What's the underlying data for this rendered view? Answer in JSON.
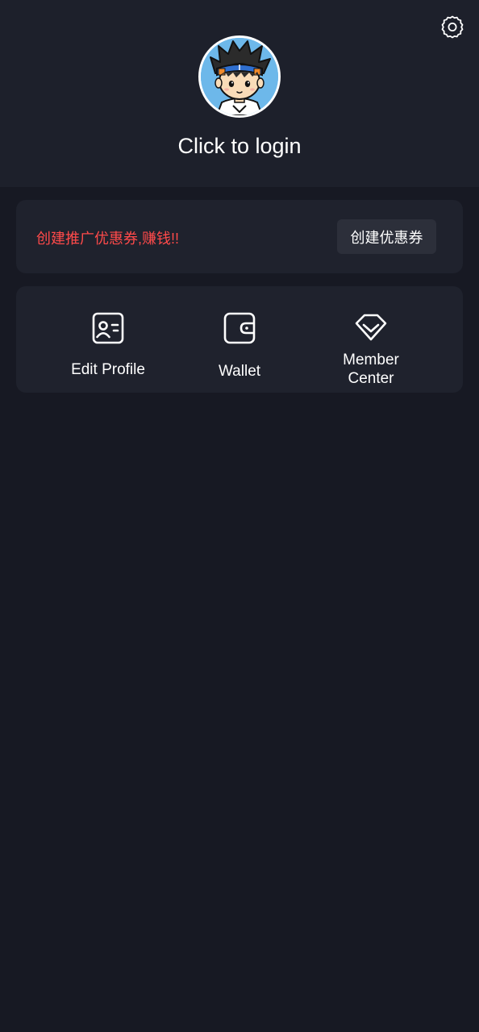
{
  "header": {
    "login_text": "Click to login",
    "settings_icon": "gear-icon",
    "avatar": "cartoon-boy-avatar"
  },
  "promo": {
    "text": "创建推广优惠券,赚钱!!",
    "button_label": "创建优惠券",
    "text_color": "#ff4a4a"
  },
  "menu": {
    "items": [
      {
        "label": "Edit Profile",
        "icon": "id-card-icon"
      },
      {
        "label": "Wallet",
        "icon": "wallet-icon"
      },
      {
        "label": "Member Center",
        "icon": "diamond-icon"
      }
    ]
  },
  "colors": {
    "background": "#171923",
    "header_bg": "#1d202b",
    "card_bg": "#1f222d",
    "button_bg": "#2c2f3a"
  }
}
